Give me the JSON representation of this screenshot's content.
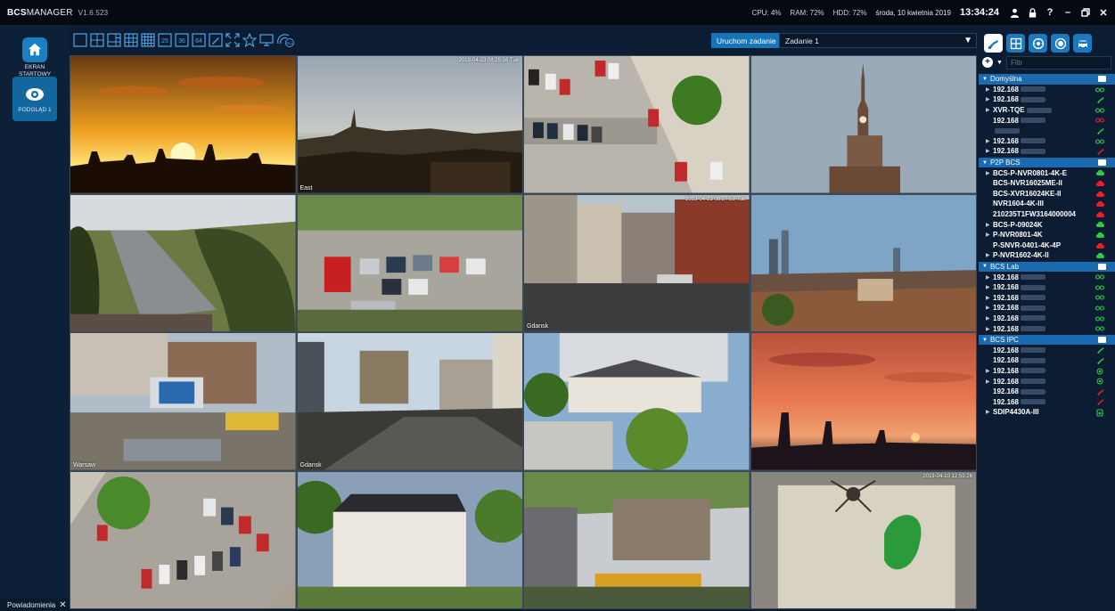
{
  "app": {
    "brand_bold": "BCS",
    "brand_rest": "MANAGER",
    "version": "V1.6.523"
  },
  "stats": {
    "cpu": "CPU:  4%",
    "ram": "RAM: 72%",
    "hdd": "HDD: 72%",
    "date": "środa, 10 kwietnia 2019",
    "time": "13:34:24"
  },
  "sidebar": {
    "items": [
      {
        "label": "EKRAN STARTOWY",
        "icon": "home-icon"
      },
      {
        "label": "PODGLĄD 1",
        "icon": "eye-icon"
      }
    ],
    "notifications_label": "Powiadomienia"
  },
  "toolbar": {
    "run_label": "Uruchom zadanie",
    "task_value": "Zadanie 1"
  },
  "cameras": [
    {
      "label": "",
      "ts": ""
    },
    {
      "label": "East",
      "ts": "2018-04-23 08:25:16 Tue"
    },
    {
      "label": "",
      "ts": ""
    },
    {
      "label": "",
      "ts": ""
    },
    {
      "label": "",
      "ts": ""
    },
    {
      "label": "",
      "ts": ""
    },
    {
      "label": "Gdansk",
      "ts": "2019-04-23 08:27:53 Tue"
    },
    {
      "label": "",
      "ts": ""
    },
    {
      "label": "Warsaw",
      "ts": ""
    },
    {
      "label": "Gdansk",
      "ts": ""
    },
    {
      "label": "",
      "ts": ""
    },
    {
      "label": "",
      "ts": ""
    },
    {
      "label": "",
      "ts": ""
    },
    {
      "label": "",
      "ts": ""
    },
    {
      "label": "",
      "ts": ""
    },
    {
      "label": "",
      "ts": "2019-04-10 12:55:26"
    }
  ],
  "right_panel": {
    "filter_placeholder": "Filtr",
    "groups": [
      {
        "name": "Domyślna",
        "devices": [
          {
            "name": "192.168",
            "expand": true,
            "status": "ok"
          },
          {
            "name": "192.168",
            "expand": true,
            "status": "link"
          },
          {
            "name": "XVR-TQE",
            "expand": true,
            "status": "ok"
          },
          {
            "name": "192.168",
            "expand": false,
            "status": "off"
          },
          {
            "name": "",
            "expand": false,
            "status": "link"
          },
          {
            "name": "192.168",
            "expand": true,
            "status": "ok"
          },
          {
            "name": "192.168",
            "expand": true,
            "status": "linkred"
          }
        ]
      },
      {
        "name": "P2P BCS",
        "devices": [
          {
            "name": "BCS-P-NVR0801-4K-E",
            "expand": true,
            "status": "cloud"
          },
          {
            "name": "BCS-NVR16025ME-II",
            "expand": false,
            "status": "cloudred"
          },
          {
            "name": "BCS-XVR16024KE-II",
            "expand": false,
            "status": "cloudred"
          },
          {
            "name": "NVR1604-4K-III",
            "expand": false,
            "status": "cloudred"
          },
          {
            "name": "210235T1FW3164000004",
            "expand": false,
            "status": "cloudred"
          },
          {
            "name": "BCS-P-09024K",
            "expand": true,
            "status": "cloud"
          },
          {
            "name": "P-NVR0801-4K",
            "expand": true,
            "status": "cloud"
          },
          {
            "name": "P-SNVR-0401-4K-4P",
            "expand": false,
            "status": "cloudred"
          },
          {
            "name": "P-NVR1602-4K-II",
            "expand": true,
            "status": "cloud"
          }
        ]
      },
      {
        "name": "BCS Lab",
        "devices": [
          {
            "name": "192.168",
            "expand": true,
            "status": "ok"
          },
          {
            "name": "192.168",
            "expand": true,
            "status": "ok"
          },
          {
            "name": "192.168",
            "expand": true,
            "status": "ok"
          },
          {
            "name": "192.168",
            "expand": true,
            "status": "ok"
          },
          {
            "name": "192.168",
            "expand": true,
            "status": "ok"
          },
          {
            "name": "192.168",
            "expand": true,
            "status": "ok"
          }
        ]
      },
      {
        "name": "BCS IPC",
        "devices": [
          {
            "name": "192.168",
            "expand": false,
            "status": "link"
          },
          {
            "name": "192.168",
            "expand": false,
            "status": "link"
          },
          {
            "name": "192.168",
            "expand": true,
            "status": "dot"
          },
          {
            "name": "192.168",
            "expand": true,
            "status": "dot"
          },
          {
            "name": "192.168",
            "expand": false,
            "status": "linkred"
          },
          {
            "name": "192.168",
            "expand": false,
            "status": "linkred"
          },
          {
            "name": "SDIP4430A-III",
            "expand": true,
            "status": "cam"
          }
        ]
      }
    ]
  },
  "colors": {
    "accent": "#1675b8",
    "group_bar": "#1a6ab0",
    "status_ok": "#2ecc40",
    "status_bad": "#e8202a"
  }
}
